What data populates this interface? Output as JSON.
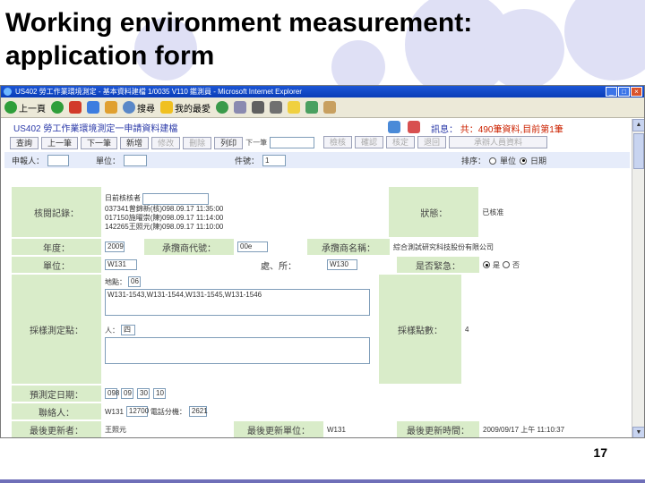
{
  "slide": {
    "title_line1": "Working environment measurement:",
    "title_line2": "application form",
    "page_number": "17"
  },
  "window": {
    "title": "US402 勞工作業環境測定 - 基本資料建檔 1/0035 V110 鑑測員 - Microsoft Internet Explorer",
    "buttons": [
      "_",
      "□",
      "×"
    ]
  },
  "toolbar": {
    "back": "上一頁",
    "search": "搜尋",
    "favorites": "我的最愛"
  },
  "app": {
    "header": "US402  勞工作業環境測定一申請資料建檔",
    "status_label": "訊息：",
    "status_text": "共：490筆資料,目前第1筆",
    "nav_buttons": [
      "查詢",
      "上一筆",
      "下一筆",
      "新增",
      "修改",
      "刪除",
      "列印"
    ],
    "nav_extra_label": "下一筆",
    "action_buttons": [
      "檢核",
      "確認",
      "核定",
      "退回",
      "承辦人員資料"
    ],
    "filter": {
      "applicant_label": "申報人：",
      "unit_label": "單位：",
      "unit_value": "",
      "code_label": "件號：",
      "code_value": "1",
      "sort_label": "排序：",
      "sort_options": [
        "單位",
        "日期"
      ],
      "sort_selected": 1
    }
  },
  "form": {
    "reviewer_label": "核閱記錄：",
    "reviewer_header": "日前核核者",
    "reviewer_lines": [
      "037341曾錦新(核)098.09.17 11:35:00",
      "017150施曜崇(陳)098.09.17 11:14:00",
      "142265王照元(陳)098.09.17 11:10:00"
    ],
    "status_label": "狀態：",
    "status_value": "已核准",
    "year_label": "年度：",
    "year_value": "2009",
    "applicant_code_label": "承攬商代號：",
    "applicant_code_value": "00e",
    "contractor_name_label": "承攬商名稱：",
    "contractor_name_value": "綜合測試研究科技股份有限公司",
    "unit_label": "單位：",
    "unit_value": "W131",
    "dept_label": "處、所：",
    "dept_value": "W130",
    "urgent_label": "是否緊急：",
    "urgent_options": [
      "是",
      "否"
    ],
    "urgent_selected": 0,
    "location_label": "採樣測定點：",
    "location_sub_label": "地點：",
    "location_code": "06",
    "location_value": "W131-1543,W131-1544,W131-1545,W131-1546",
    "count_label": "採樣點數：",
    "count_value": "4",
    "person_label": "人：",
    "person_value": "四",
    "date_label": "預測定日期：",
    "date_parts": [
      "098",
      "09",
      "30",
      "10"
    ],
    "contact_label": "聯絡人：",
    "contact_value": "W131",
    "contact_phone": "12700",
    "ext_label": "電話分機：",
    "ext_value": "2621",
    "last_updater_label": "最後更新者：",
    "last_updater_value": "王照元",
    "last_unit_label": "最後更新單位：",
    "last_unit_value": "W131",
    "last_time_label": "最後更新時間：",
    "last_time_value": "2009/09/17 上午 11:10:37"
  }
}
